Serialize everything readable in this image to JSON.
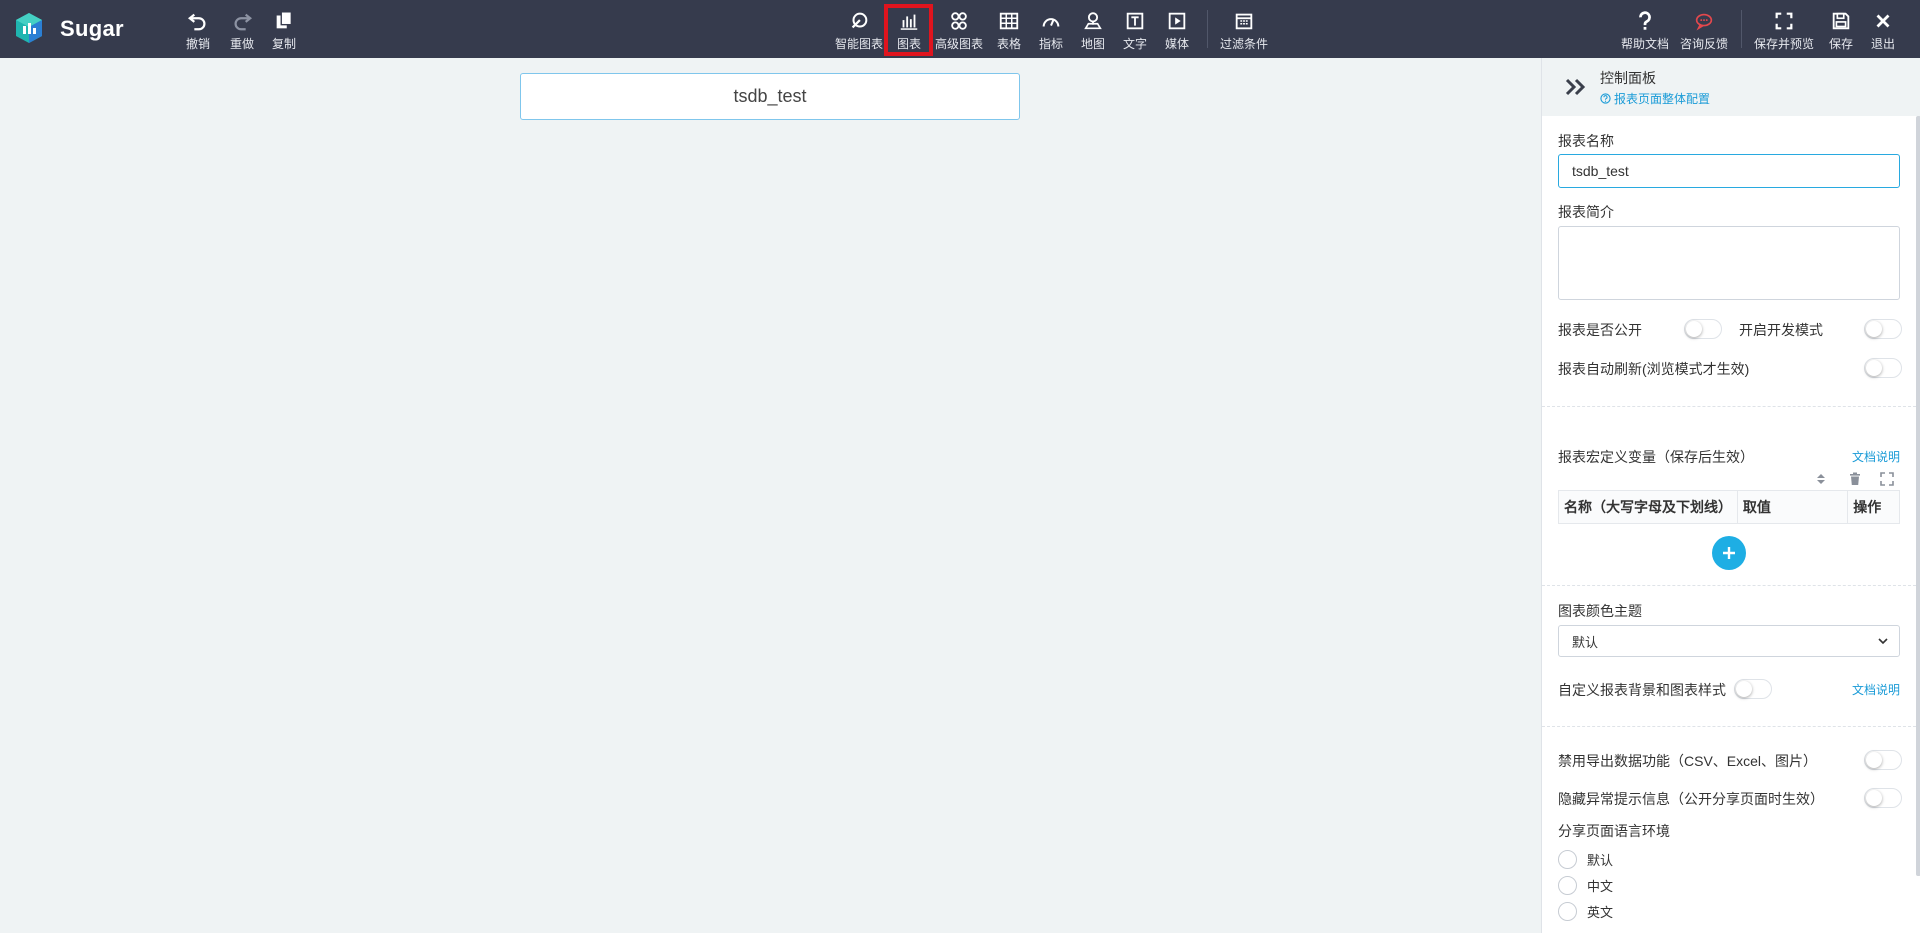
{
  "brand": "Sugar",
  "toolbar_left": [
    {
      "label": "撤销",
      "icon": "undo-icon"
    },
    {
      "label": "重做",
      "icon": "redo-icon"
    },
    {
      "label": "复制",
      "icon": "copy-icon"
    }
  ],
  "toolbar_center": [
    {
      "label": "智能图表",
      "icon": "smart-chart-icon"
    },
    {
      "label": "图表",
      "icon": "bar-chart-icon"
    },
    {
      "label": "高级图表",
      "icon": "advanced-chart-icon"
    },
    {
      "label": "表格",
      "icon": "table-icon"
    },
    {
      "label": "指标",
      "icon": "gauge-icon"
    },
    {
      "label": "地图",
      "icon": "map-pin-icon"
    },
    {
      "label": "文字",
      "icon": "text-icon"
    },
    {
      "label": "媒体",
      "icon": "media-play-icon"
    },
    {
      "label": "过滤条件",
      "icon": "filter-calendar-icon"
    }
  ],
  "toolbar_right": [
    {
      "label": "帮助文档",
      "icon": "help-icon"
    },
    {
      "label": "咨询反馈",
      "icon": "chat-icon"
    },
    {
      "label": "保存并预览",
      "icon": "fullscreen-icon"
    },
    {
      "label": "保存",
      "icon": "save-icon"
    },
    {
      "label": "退出",
      "icon": "close-icon"
    }
  ],
  "colors": {
    "topbar": "#363b4d",
    "accent": "#1eaee4",
    "highlight": "#e0141e",
    "chat": "#e5484d"
  },
  "canvas": {
    "report_title": "tsdb_test"
  },
  "panel": {
    "title": "控制面板",
    "subtitle": "报表页面整体配置",
    "name_label": "报表名称",
    "name_value": "tsdb_test",
    "intro_label": "报表简介",
    "intro_value": "",
    "public_label": "报表是否公开",
    "dev_label": "开启开发模式",
    "auto_refresh_label": "报表自动刷新(浏览模式才生效)",
    "macro_label": "报表宏定义变量（保存后生效）",
    "doc_link": "文档说明",
    "table_headers": [
      "名称（大写字母及下划线）",
      "取值",
      "操作"
    ],
    "theme_label": "图表颜色主题",
    "theme_value": "默认",
    "custom_bg_label": "自定义报表背景和图表样式",
    "doc_link2": "文档说明",
    "disable_export_label": "禁用导出数据功能（CSV、Excel、图片）",
    "hide_error_label": "隐藏异常提示信息（公开分享页面时生效）",
    "lang_label": "分享页面语言环境",
    "lang_options": [
      "默认",
      "中文",
      "英文"
    ]
  }
}
